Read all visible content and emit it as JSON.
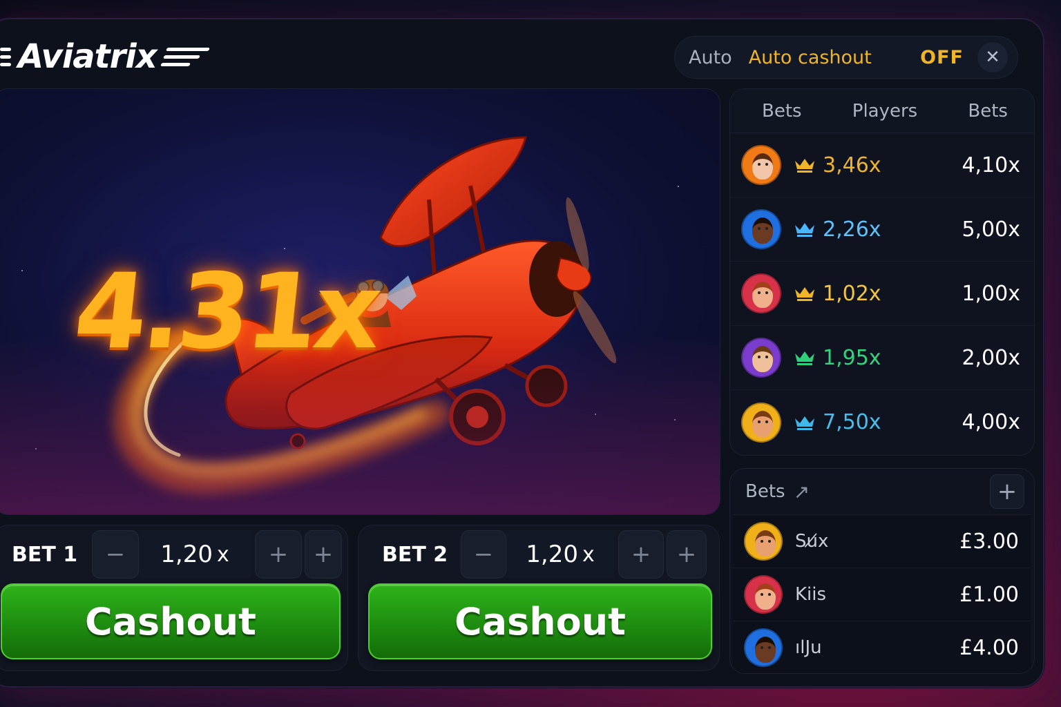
{
  "header": {
    "logo_text": "Aviatrix",
    "auto_label": "Auto",
    "auto_cashout_label": "Auto cashout",
    "auto_cashout_state": "OFF",
    "close_symbol": "✕"
  },
  "game": {
    "multiplier": "4.31x",
    "accent_color": "#ffb31f"
  },
  "bet_panels": [
    {
      "label": "BET 1",
      "value": "1,20",
      "unit": "x",
      "minus": "−",
      "plus": "+",
      "button": "Cashout"
    },
    {
      "label": "BET 2",
      "value": "1,20",
      "unit": "x",
      "minus": "−",
      "plus": "+",
      "button": "Cashout"
    }
  ],
  "leaderboard": {
    "tabs": [
      "Bets",
      "Players",
      "Bets"
    ],
    "rows": [
      {
        "avatar": "avatar-orange",
        "crown_color": "#f0b429",
        "mult": "3,46",
        "mult_color": "#f0b429",
        "right": "4,10"
      },
      {
        "avatar": "avatar-blue",
        "crown_color": "#49b6ff",
        "mult": "2,26",
        "mult_color": "#5cc2ff",
        "right": "5,00"
      },
      {
        "avatar": "avatar-red",
        "crown_color": "#f0b429",
        "mult": "1,02",
        "mult_color": "#f5c63a",
        "right": "1,00"
      },
      {
        "avatar": "avatar-purple",
        "crown_color": "#2fd07a",
        "mult": "1,95",
        "mult_color": "#33d27c",
        "right": "2,00"
      },
      {
        "avatar": "avatar-yellow",
        "crown_color": "#3fb7e8",
        "mult": "7,50",
        "mult_color": "#45c0ee",
        "right": "4,00"
      }
    ],
    "unit": "x"
  },
  "bets_feed": {
    "title": "Bets",
    "arrow_symbol": "↗",
    "plus_symbol": "+",
    "rows": [
      {
        "avatar": "avatar-yellow",
        "name": "Su̸x",
        "amount": "£3.00"
      },
      {
        "avatar": "avatar-red",
        "name": "Kiis",
        "amount": "£1.00"
      },
      {
        "avatar": "avatar-blue",
        "name": "ılJu",
        "amount": "£4.00"
      }
    ]
  }
}
